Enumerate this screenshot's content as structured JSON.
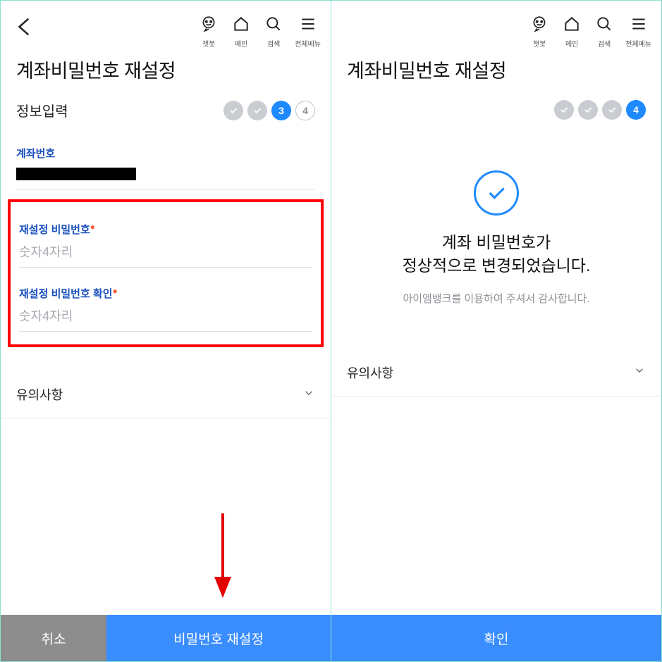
{
  "toolbar": {
    "chatbot": "챗봇",
    "main": "메인",
    "search": "검색",
    "menu": "전체메뉴"
  },
  "left": {
    "page_title": "계좌비밀번호 재설정",
    "step_name": "정보입력",
    "step_current_num": "3",
    "step_next_num": "4",
    "account_label": "계좌번호",
    "new_pw_label": "재설정 비밀번호",
    "new_pw_placeholder": "숫자4자리",
    "confirm_pw_label": "재설정 비밀번호 확인",
    "confirm_pw_placeholder": "숫자4자리",
    "notice_label": "유의사항",
    "cancel_label": "취소",
    "submit_label": "비밀번호 재설정"
  },
  "right": {
    "page_title": "계좌비밀번호 재설정",
    "step_current_num": "4",
    "success_line1": "계좌 비밀번호가",
    "success_line2": "정상적으로 변경되었습니다.",
    "success_sub": "아이엠뱅크를 이용하여 주셔서 감사합니다.",
    "notice_label": "유의사항",
    "confirm_label": "확인"
  }
}
